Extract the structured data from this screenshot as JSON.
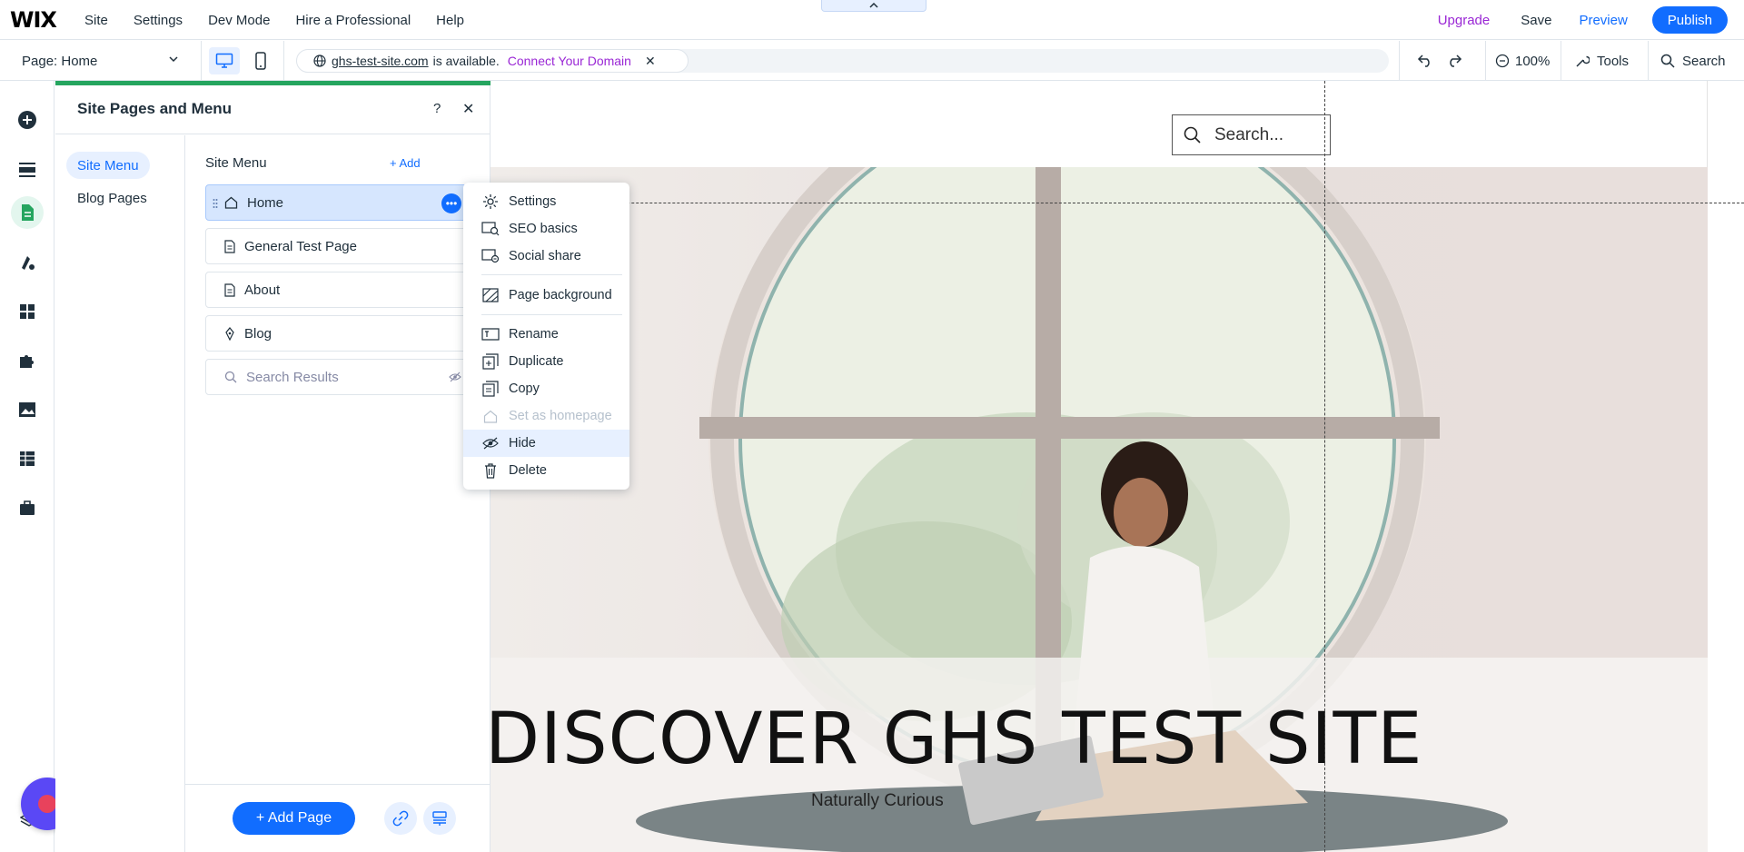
{
  "topbar": {
    "logo": "WIX",
    "nav": [
      "Site",
      "Settings",
      "Dev Mode",
      "Hire a Professional",
      "Help"
    ],
    "upgrade": "Upgrade",
    "save": "Save",
    "preview": "Preview",
    "publish": "Publish"
  },
  "subbar": {
    "page_label": "Page: Home",
    "domain_name": "ghs-test-site.com",
    "domain_text": "is available.",
    "domain_link": "Connect Your Domain",
    "domain_close": "✕",
    "zoom": "100%",
    "tools": "Tools",
    "search": "Search"
  },
  "panel": {
    "title": "Site Pages and Menu",
    "help": "?",
    "close": "✕",
    "left_items": [
      "Site Menu",
      "Blog Pages"
    ],
    "section_title": "Site Menu",
    "add": "+ Add",
    "pages": [
      {
        "label": "Home",
        "icon": "home-icon"
      },
      {
        "label": "General Test Page",
        "icon": "page-icon"
      },
      {
        "label": "About",
        "icon": "page-icon"
      },
      {
        "label": "Blog",
        "icon": "blog-icon"
      },
      {
        "label": "Search Results",
        "icon": "search-icon"
      }
    ],
    "add_page": "+ Add Page"
  },
  "context_menu": {
    "items": [
      {
        "label": "Settings",
        "icon": "gear-icon"
      },
      {
        "label": "SEO basics",
        "icon": "seo-icon"
      },
      {
        "label": "Social share",
        "icon": "social-share-icon"
      },
      {
        "label": "Page background",
        "icon": "background-icon"
      },
      {
        "label": "Rename",
        "icon": "rename-icon"
      },
      {
        "label": "Duplicate",
        "icon": "duplicate-icon"
      },
      {
        "label": "Copy",
        "icon": "copy-icon"
      },
      {
        "label": "Set as homepage",
        "icon": "home-icon",
        "disabled": true
      },
      {
        "label": "Hide",
        "icon": "hide-icon"
      },
      {
        "label": "Delete",
        "icon": "trash-icon"
      }
    ]
  },
  "site": {
    "search_placeholder": "Search...",
    "hero_title": "DISCOVER GHS TEST SITE",
    "hero_subtitle": "Naturally Curious"
  },
  "colors": {
    "accent": "#116dff",
    "upgrade": "#9a27d5",
    "panel_topline": "#25a55f"
  }
}
